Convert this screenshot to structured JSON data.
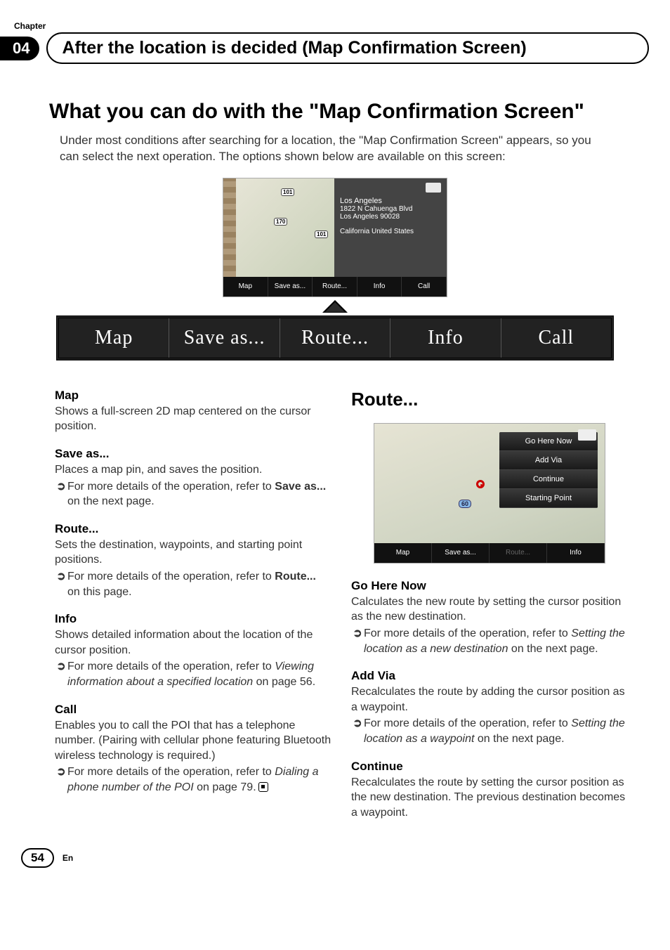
{
  "chapter_label": "Chapter",
  "chapter_number": "04",
  "header_title": "After the location is decided (Map Confirmation Screen)",
  "main_title": "What you can do with the \"Map Confirmation Screen\"",
  "intro": "Under most conditions after searching for a location, the \"Map Confirmation Screen\" appears, so you can select the next operation. The options shown below are available on this screen:",
  "top_screenshot": {
    "routes": {
      "r1": "101",
      "r2": "170",
      "r3": "101"
    },
    "info": {
      "city": "Los Angeles",
      "address": "1822 N Cahuenga Blvd",
      "citystate": "Los Angeles 90028",
      "country": "California   United States"
    },
    "bottom": {
      "map": "Map",
      "save": "Save as...",
      "route": "Route...",
      "info": "Info",
      "call": "Call"
    }
  },
  "bigbar": {
    "map": "Map",
    "save": "Save as...",
    "route": "Route...",
    "info": "Info",
    "call": "Call"
  },
  "left": {
    "map": {
      "h": "Map",
      "p": "Shows a full-screen 2D map centered on the cursor position."
    },
    "save": {
      "h": "Save as...",
      "p": "Places a map pin, and saves the position.",
      "ref_prefix": "For more details of the operation, refer to ",
      "ref_bold": "Save as...",
      "ref_suffix": " on the next page."
    },
    "route": {
      "h": "Route...",
      "p": "Sets the destination, waypoints, and starting point positions.",
      "ref_prefix": "For more details of the operation, refer to ",
      "ref_bold": "Route...",
      "ref_suffix": " on this page."
    },
    "info": {
      "h": "Info",
      "p": "Shows detailed information about the location of the cursor position.",
      "ref_prefix": "For more details of the operation, refer to ",
      "ref_ital": "Viewing information about a specified location",
      "ref_suffix": " on page 56."
    },
    "call": {
      "h": "Call",
      "p": "Enables you to call the POI that has a telephone number. (Pairing with cellular phone featuring Bluetooth wireless technology is required.)",
      "ref_prefix": "For more details of the operation, refer to ",
      "ref_ital": "Dialing a phone number of the POI",
      "ref_suffix": " on page 79."
    }
  },
  "right": {
    "heading": "Route...",
    "menu": {
      "go": "Go Here Now",
      "add": "Add Via",
      "cont": "Continue",
      "start": "Starting Point"
    },
    "hwy": "60",
    "bottom": {
      "map": "Map",
      "save": "Save as...",
      "route": "Route...",
      "info": "Info"
    },
    "go": {
      "h": "Go Here Now",
      "p": "Calculates the new route by setting the cursor position as the new destination.",
      "ref_prefix": "For more details of the operation, refer to ",
      "ref_ital": "Setting the location as a new destination",
      "ref_suffix": " on the next page."
    },
    "add": {
      "h": "Add Via",
      "p": "Recalculates the route by adding the cursor position as a waypoint.",
      "ref_prefix": "For more details of the operation, refer to ",
      "ref_ital": "Setting the location as a waypoint",
      "ref_suffix": " on the next page."
    },
    "cont": {
      "h": "Continue",
      "p": "Recalculates the route by setting the cursor position as the new destination. The previous destination becomes a waypoint."
    }
  },
  "page_number": "54",
  "lang": "En"
}
